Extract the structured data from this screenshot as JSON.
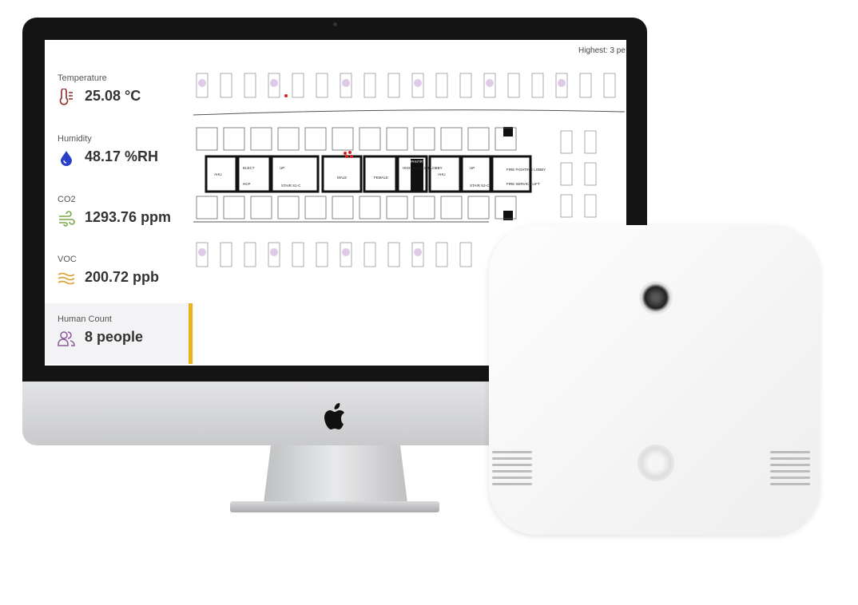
{
  "dashboard": {
    "metrics": [
      {
        "label": "Temperature",
        "value": "25.08 °C",
        "icon": "thermometer-icon",
        "color": "#8b2a2a"
      },
      {
        "label": "Humidity",
        "value": "48.17 %RH",
        "icon": "water-drop-icon",
        "color": "#2a3fc9"
      },
      {
        "label": "CO2",
        "value": "1293.76 ppm",
        "icon": "wind-icon",
        "color": "#7aa84a"
      },
      {
        "label": "VOC",
        "value": "200.72 ppb",
        "icon": "waves-icon",
        "color": "#d9a43a"
      },
      {
        "label": "Human Count",
        "value": "8 people",
        "icon": "people-icon",
        "color": "#8a5a9a"
      }
    ],
    "accent_color": "#e9b31c",
    "highest_label": "Highest: 3 pe"
  },
  "floor_plan": {
    "rooms": [
      "AHU",
      "ELECT",
      "HCP",
      "UP",
      "STAIR S1-C",
      "MALE",
      "FEMALE",
      "HIGH RISE LIFT LOBBY",
      "PANTRY",
      "AHU",
      "UP",
      "STAIR S2-C",
      "FIRE FIGHTING LOBBY",
      "FIRE SERVICE LIFT"
    ]
  }
}
